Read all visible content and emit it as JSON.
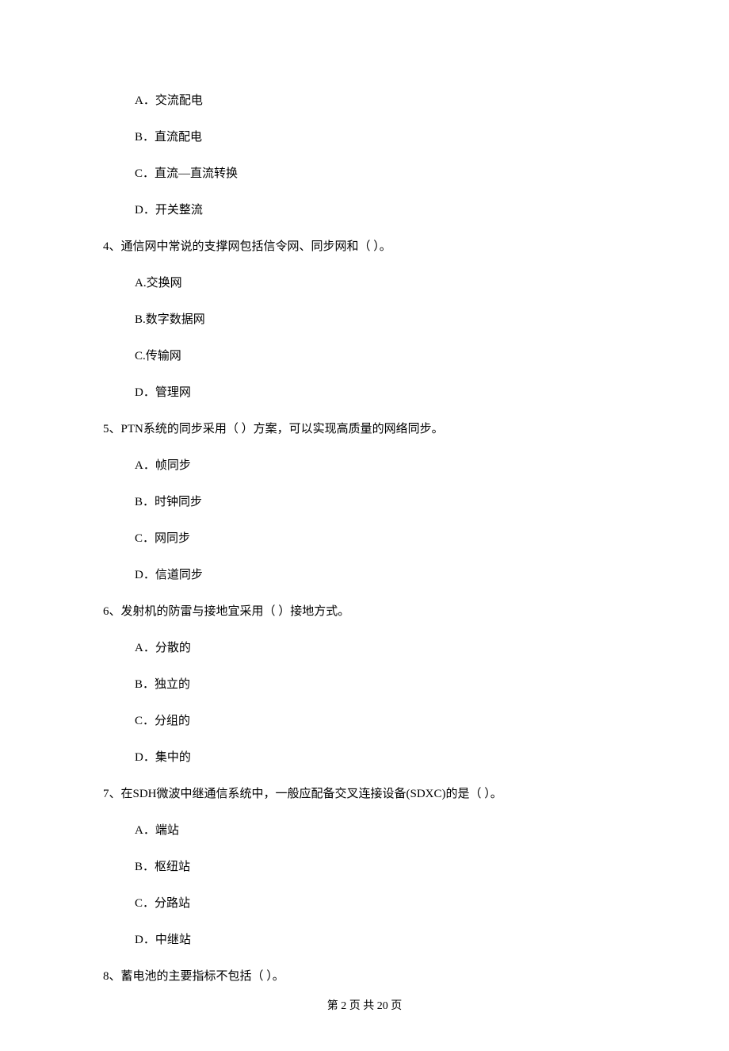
{
  "q3": {
    "options": {
      "a": "A．交流配电",
      "b": "B．直流配电",
      "c": "C．直流—直流转换",
      "d": "D．开关整流"
    }
  },
  "q4": {
    "text": "4、通信网中常说的支撑网包括信令网、同步网和（    ）。",
    "options": {
      "a": "A.交换网",
      "b": "B.数字数据网",
      "c": "C.传输网",
      "d": "D．管理网"
    }
  },
  "q5": {
    "text": "5、PTN系统的同步采用（    ）方案，可以实现高质量的网络同步。",
    "options": {
      "a": "A．帧同步",
      "b": "B．时钟同步",
      "c": "C．网同步",
      "d": "D．信道同步"
    }
  },
  "q6": {
    "text": "6、发射机的防雷与接地宜采用（    ）接地方式。",
    "options": {
      "a": "A．分散的",
      "b": "B．独立的",
      "c": "C．分组的",
      "d": "D．集中的"
    }
  },
  "q7": {
    "text": "7、在SDH微波中继通信系统中，一般应配备交叉连接设备(SDXC)的是（    ）。",
    "options": {
      "a": "A．端站",
      "b": "B．枢纽站",
      "c": "C．分路站",
      "d": "D．中继站"
    }
  },
  "q8": {
    "text": "8、蓄电池的主要指标不包括（    ）。"
  },
  "footer": "第 2 页 共 20 页"
}
